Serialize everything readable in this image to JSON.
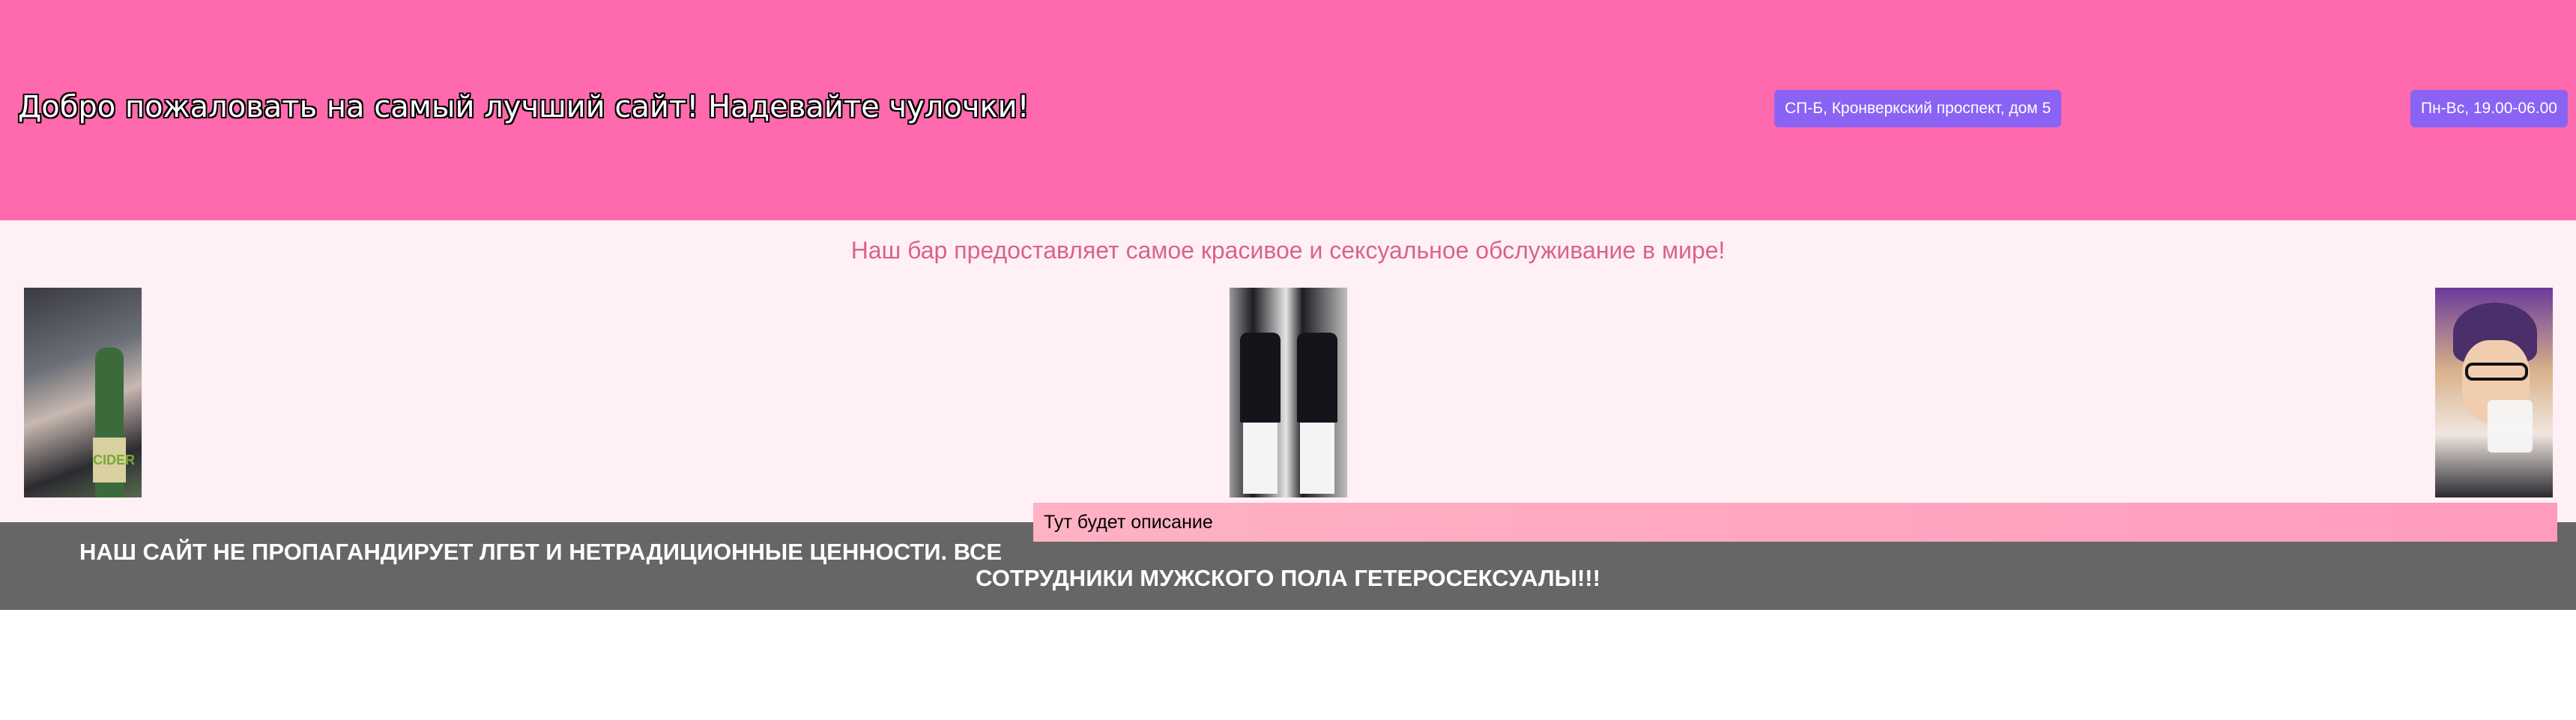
{
  "header": {
    "title": "Добро пожаловать на самый лучший сайт! Надевайте чулочки!",
    "address": "СП-Б, Кронверкский проспект, дом 5",
    "hours": "Пн-Вс, 19.00-06.00"
  },
  "main": {
    "tagline": "Наш бар предоставляет самое красивое и сексуальное обслуживание в мире!",
    "photos": [
      {
        "label": "CIDER",
        "icon": "photo-bottle"
      },
      {
        "icon": "photo-two-people"
      },
      {
        "icon": "photo-person-drinking"
      }
    ],
    "description": "Тут будет описание"
  },
  "footer": {
    "line1": "НАШ САЙТ НЕ ПРОПАГАНДИРУЕТ ЛГБТ И НЕТРАДИЦИОННЫЕ ЦЕННОСТИ. ВСЕ",
    "line2": "СОТРУДНИКИ МУЖСКОГО ПОЛА ГЕТЕРОСЕКСУАЛЫ!!!"
  },
  "colors": {
    "header_bg": "#ff69ad",
    "badge_bg": "#8a63f5",
    "content_bg": "#fff0f5",
    "tagline": "#d9628f",
    "footer_bg": "#666666"
  }
}
